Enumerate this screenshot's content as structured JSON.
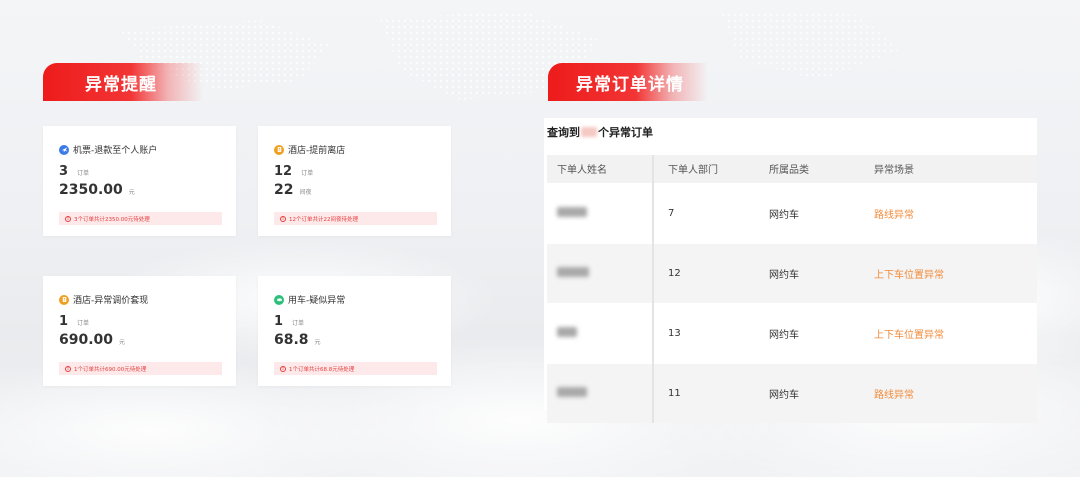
{
  "left_section": {
    "title": "异常提醒",
    "cards": [
      {
        "icon": "plane-icon",
        "icon_color": "#3a7be8",
        "title": "机票-退款至个人账户",
        "metric1": {
          "value": "3",
          "unit": "订单"
        },
        "metric2": {
          "value": "2350.00",
          "unit": "元"
        },
        "note": "3个订单共计2350.00元待处理"
      },
      {
        "icon": "hotel-icon",
        "icon_color": "#f0a020",
        "title": "酒店-提前离店",
        "metric1": {
          "value": "12",
          "unit": "订单"
        },
        "metric2": {
          "value": "22",
          "unit": "间夜"
        },
        "note": "12个订单共计22间夜待处理"
      },
      {
        "icon": "hotel-icon",
        "icon_color": "#f0a020",
        "title": "酒店-异常调价套现",
        "metric1": {
          "value": "1",
          "unit": "订单"
        },
        "metric2": {
          "value": "690.00",
          "unit": "元"
        },
        "note": "1个订单共计690.00元待处理"
      },
      {
        "icon": "car-icon",
        "icon_color": "#2cbf7a",
        "title": "用车-疑似异常",
        "metric1": {
          "value": "1",
          "unit": "订单"
        },
        "metric2": {
          "value": "68.8",
          "unit": "元"
        },
        "note": "1个订单共计68.8元待处理"
      }
    ]
  },
  "right_section": {
    "title": "异常订单详情",
    "query_prefix": "查询到",
    "query_suffix": "个异常订单",
    "table": {
      "columns": [
        "下单人姓名",
        "下单人部门",
        "所属品类",
        "异常场景"
      ],
      "rows": [
        {
          "dept": "7",
          "category": "网约车",
          "scene": "路线异常"
        },
        {
          "dept": "12",
          "category": "网约车",
          "scene": "上下车位置异常"
        },
        {
          "dept": "13",
          "category": "网约车",
          "scene": "上下车位置异常"
        },
        {
          "dept": "11",
          "category": "网约车",
          "scene": "路线异常"
        }
      ]
    }
  },
  "colors": {
    "accent_red": "#ee1b1b",
    "warning_text": "#e83c3c",
    "scene_orange": "#f08b3b"
  }
}
